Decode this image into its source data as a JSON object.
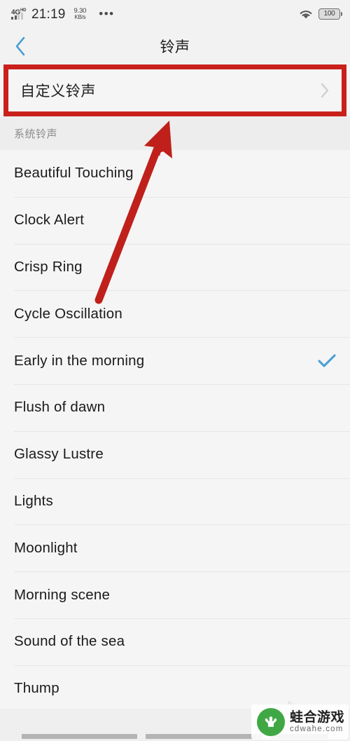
{
  "status_bar": {
    "network_type": "4G",
    "network_type_sup": "HD",
    "time": "21:19",
    "net_speed_value": "9.30",
    "net_speed_unit": "KB/s",
    "overflow_dots": "•••",
    "wifi_icon": "wifi-icon",
    "battery_level": "100"
  },
  "header": {
    "back_icon": "chevron-left-icon",
    "title": "铃声"
  },
  "custom_ringtone": {
    "label": "自定义铃声",
    "chevron_icon": "chevron-right-icon",
    "highlight_color": "#c9201b"
  },
  "section": {
    "title": "系统铃声"
  },
  "ringtones": [
    {
      "name": "Beautiful Touching",
      "selected": false
    },
    {
      "name": "Clock Alert",
      "selected": false
    },
    {
      "name": "Crisp Ring",
      "selected": false
    },
    {
      "name": "Cycle Oscillation",
      "selected": false
    },
    {
      "name": "Early in the morning",
      "selected": true
    },
    {
      "name": "Flush of dawn",
      "selected": false
    },
    {
      "name": "Glassy Lustre",
      "selected": false
    },
    {
      "name": "Lights",
      "selected": false
    },
    {
      "name": "Moonlight",
      "selected": false
    },
    {
      "name": "Morning scene",
      "selected": false
    },
    {
      "name": "Sound of the sea",
      "selected": false
    },
    {
      "name": "Thump",
      "selected": false
    }
  ],
  "selected_check": {
    "icon": "check-icon",
    "color": "#4d9fd6"
  },
  "annotation": {
    "arrow_icon": "red-arrow-up-right",
    "color": "#c0201b"
  },
  "watermark": {
    "name": "蛙合游戏",
    "url": "cdwahe.com",
    "logo_icon": "frog-logo-icon",
    "logo_color": "#3fa845"
  },
  "nav_bar": {
    "recents_icon": "recents-pill",
    "home_icon": "home-pill",
    "back_icon": "back-pill"
  }
}
